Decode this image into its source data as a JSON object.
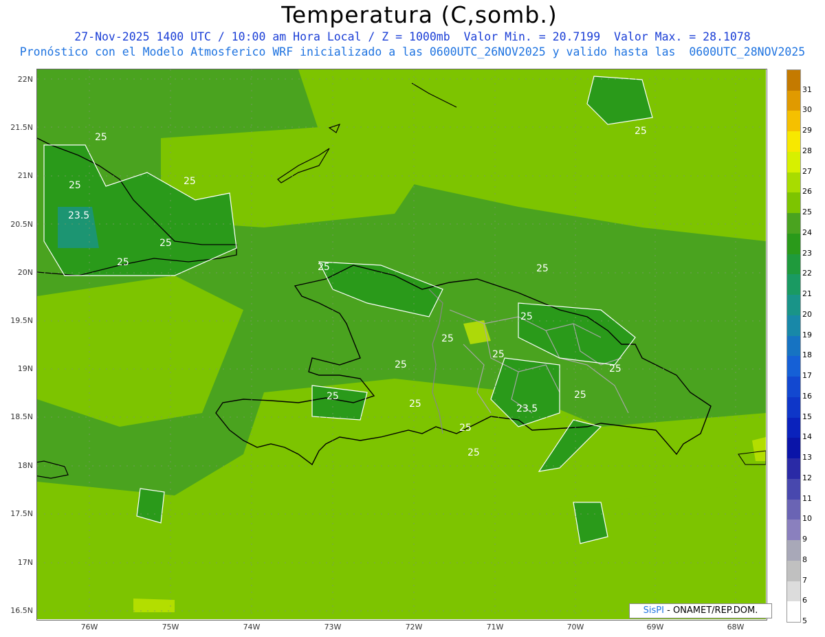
{
  "header": {
    "title": "Temperatura (C,somb.)",
    "line1": "27-Nov-2025 1400 UTC / 10:00 am Hora Local / Z = 1000mb  Valor Min. = 20.7199  Valor Max. = 28.1078",
    "line2": "Pronóstico con el Modelo Atmosferico WRF inicializado a las 0600UTC_26NOV2025 y valido hasta las  0600UTC_28NOV2025"
  },
  "axes": {
    "lat_labels": [
      "22N",
      "21.5N",
      "21N",
      "20.5N",
      "20N",
      "19.5N",
      "19N",
      "18.5N",
      "18N",
      "17.5N",
      "17N",
      "16.5N"
    ],
    "lon_labels": [
      "76W",
      "75W",
      "74W",
      "73W",
      "72W",
      "71W",
      "70W",
      "69W",
      "68W"
    ]
  },
  "contour_labels": [
    "25",
    "25",
    "23.5",
    "25",
    "25",
    "25",
    "25",
    "25",
    "25",
    "25",
    "25",
    "23.5",
    "25",
    "25",
    "25",
    "25",
    "25",
    "25",
    "25",
    "25"
  ],
  "colorbar": {
    "labels": [
      "31",
      "30",
      "29",
      "28",
      "27",
      "26",
      "25",
      "24",
      "23",
      "22",
      "21",
      "20",
      "19",
      "18",
      "17",
      "16",
      "15",
      "14",
      "13",
      "12",
      "11",
      "10",
      "9",
      "8",
      "7",
      "6",
      "5"
    ],
    "colors": [
      "#c47a00",
      "#e09a00",
      "#f5c000",
      "#f7e800",
      "#d7f000",
      "#a8dc00",
      "#7dc400",
      "#4aa31f",
      "#2a9a1a",
      "#1f9a3c",
      "#1a9a62",
      "#199488",
      "#1888a8",
      "#1673c2",
      "#1560d6",
      "#1248d0",
      "#0e36c8",
      "#0a22bc",
      "#0a14a8",
      "#2a2aa6",
      "#4848ae",
      "#6a64b4",
      "#8a80be",
      "#a8a8b8",
      "#c0c0c0",
      "#dcdcdc",
      "#ffffff"
    ],
    "brand_accent": "#1e73e0"
  },
  "credit": {
    "sis": "SisPI",
    "rest": " - ONAMET/REP.DOM."
  }
}
